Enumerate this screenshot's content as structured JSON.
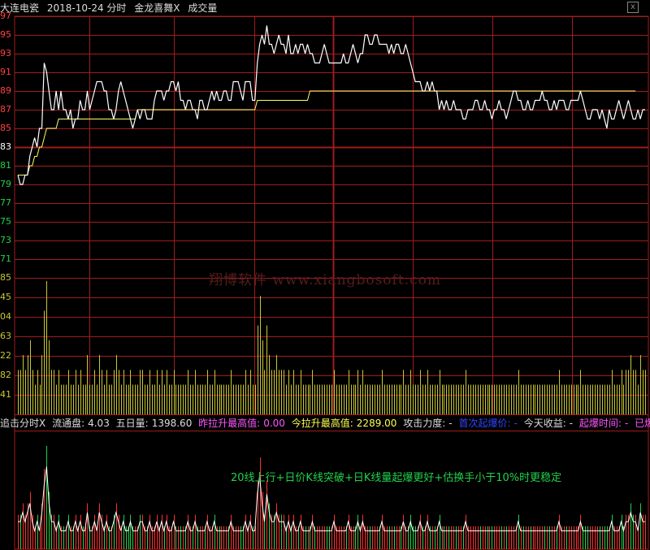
{
  "header": {
    "stock": "大连电瓷",
    "date": "2018-10-24 分时",
    "indicator": "金龙喜舞",
    "close_mark": "X",
    "volume_label": "成交量",
    "close_button": "x"
  },
  "price_axis": [
    "97",
    "95",
    "93",
    "91",
    "89",
    "87",
    "85",
    "83",
    "81",
    "79",
    "77",
    "75",
    "73",
    "71"
  ],
  "volume_axis": [
    "85",
    "45",
    "04",
    "63",
    "22",
    "82",
    "41"
  ],
  "watermark": "翔博软件 www.xiangbosoft.com",
  "info_bar": {
    "title": "追击分时X",
    "float_label": "流通盘:",
    "float_value": "4.03",
    "avg5_label": "五日量:",
    "avg5_value": "1398.60",
    "prev_high_label": "昨拉升最高值:",
    "prev_high_value": "0.00",
    "today_high_label": "今拉升最高值:",
    "today_high_value": "2289.00",
    "attack_label": "攻击力度:",
    "attack_value": "-",
    "first_explode_label": "首次起爆价:",
    "first_explode_value": "-",
    "today_gain_label": "今天收益:",
    "today_gain_value": "-",
    "explode_time_label": "起爆时间:",
    "explode_time_value": "-",
    "explode_minute_label": "已爆分钟:",
    "explode_minute_value": "-"
  },
  "strategy_note": "20线上行+日价K线突破+日K线量起爆更好+估换手小于10%时更稳定",
  "colors": {
    "grid": "#a01c1c",
    "price_line": "#ffffff",
    "avg_line": "#ffff66",
    "volume_bar": "#c8c832",
    "up_bar": "#ff3030",
    "down_bar": "#22d24a",
    "axis_up": "#ff4040",
    "axis_flat": "#ffffff",
    "axis_down": "#22d24a"
  },
  "chart_data": {
    "type": "line",
    "price_series": [
      81,
      80,
      80,
      81,
      81,
      83,
      84,
      85,
      84,
      86,
      86,
      93,
      92,
      90,
      88,
      88,
      90,
      88,
      90,
      88,
      88,
      87,
      88,
      86,
      87,
      87,
      89,
      88,
      88,
      90,
      88,
      89,
      90,
      91,
      91,
      91,
      90,
      90,
      88,
      88,
      87,
      88,
      90,
      91,
      90,
      89,
      88,
      87,
      86,
      87,
      88,
      87,
      88,
      88,
      87,
      87,
      87,
      89,
      90,
      90,
      90,
      89,
      90,
      90,
      91,
      91,
      90,
      91,
      89,
      89,
      88,
      89,
      89,
      88,
      88,
      87,
      89,
      89,
      88,
      88,
      89,
      90,
      89,
      90,
      89,
      89,
      90,
      90,
      89,
      89,
      91,
      91,
      91,
      90,
      89,
      91,
      91,
      91,
      89,
      89,
      93,
      95,
      96,
      95,
      97,
      95,
      95,
      94,
      95,
      96,
      95,
      95,
      94,
      96,
      94,
      94,
      95,
      94,
      95,
      95,
      94,
      95,
      94,
      94,
      93,
      93,
      93,
      94,
      95,
      94,
      93,
      93,
      93,
      93,
      93,
      93,
      94,
      93,
      93,
      94,
      95,
      94,
      93,
      94,
      94,
      96,
      96,
      95,
      95,
      96,
      96,
      95,
      95,
      95,
      95,
      94,
      95,
      94,
      95,
      95,
      94,
      94,
      95,
      94,
      93,
      92,
      91,
      91,
      91,
      90,
      90,
      91,
      90,
      91,
      90,
      90,
      88,
      89,
      88,
      89,
      88,
      88,
      89,
      88,
      88,
      88,
      87,
      87,
      88,
      88,
      88,
      89,
      89,
      88,
      88,
      89,
      88,
      88,
      87,
      88,
      88,
      89,
      88,
      88,
      87,
      88,
      89,
      90,
      90,
      89,
      89,
      88,
      88,
      89,
      88,
      88,
      89,
      89,
      89,
      90,
      89,
      89,
      88,
      88,
      89,
      88,
      89,
      89,
      89,
      88,
      88,
      89,
      89,
      89,
      89,
      90,
      89,
      88,
      87,
      87,
      88,
      88,
      88,
      87,
      88,
      87,
      86,
      88,
      87,
      87,
      88,
      89,
      88,
      87,
      88,
      89,
      88,
      87,
      87,
      88,
      87,
      88,
      88
    ],
    "avg_series": [
      81,
      81,
      81,
      81,
      81,
      82,
      82,
      83,
      83,
      84,
      84,
      85,
      86,
      86,
      86,
      86,
      86,
      87,
      87,
      87,
      87,
      87,
      87,
      87,
      87,
      87,
      87,
      87,
      87,
      87,
      87,
      87,
      87,
      87,
      87,
      87,
      87,
      87,
      87,
      87,
      87,
      87,
      87,
      87,
      87,
      87,
      87,
      87,
      87,
      87,
      88,
      88,
      88,
      88,
      88,
      88,
      88,
      88,
      88,
      88,
      88,
      88,
      88,
      88,
      88,
      88,
      88,
      88,
      88,
      88,
      88,
      88,
      88,
      88,
      88,
      88,
      88,
      88,
      88,
      88,
      88,
      88,
      88,
      88,
      88,
      88,
      88,
      88,
      88,
      88,
      88,
      88,
      88,
      88,
      88,
      88,
      88,
      88,
      88,
      88,
      89,
      89,
      89,
      89,
      89,
      89,
      89,
      89,
      89,
      89,
      89,
      89,
      89,
      89,
      89,
      89,
      89,
      89,
      89,
      89,
      89,
      89,
      90,
      90,
      90,
      90,
      90,
      90,
      90,
      90,
      90,
      90,
      90,
      90,
      90,
      90,
      90,
      90,
      90,
      90,
      90,
      90,
      90,
      90,
      90,
      90,
      90,
      90,
      90,
      90,
      90,
      90,
      90,
      90,
      90,
      90,
      90,
      90,
      90,
      90,
      90,
      90,
      90,
      90,
      90,
      90,
      90,
      90,
      90,
      90,
      90,
      90,
      90,
      90,
      90,
      90,
      90,
      90,
      90,
      90,
      90,
      90,
      90,
      90,
      90,
      90,
      90,
      90,
      90,
      90,
      90,
      90,
      90,
      90,
      90,
      90,
      90,
      90,
      90,
      90,
      90,
      90,
      90,
      90,
      90,
      90,
      90,
      90,
      90,
      90,
      90,
      90,
      90,
      90,
      90,
      90,
      90,
      90,
      90,
      90,
      90,
      90,
      90,
      90,
      90,
      90,
      90,
      90,
      90,
      90,
      90,
      90,
      90,
      90,
      90,
      90,
      90,
      90,
      90,
      90,
      90,
      90,
      90,
      90,
      90,
      90,
      90,
      90,
      90,
      90,
      90,
      90,
      90,
      90,
      90,
      90,
      90,
      90,
      90
    ],
    "volume_series": [
      3,
      3,
      4,
      3,
      4,
      5,
      3,
      2,
      3,
      2,
      4,
      7,
      9,
      5,
      3,
      3,
      2,
      3,
      2,
      2,
      2,
      3,
      2,
      2,
      3,
      2,
      3,
      2,
      2,
      4,
      2,
      2,
      3,
      2,
      4,
      3,
      2,
      3,
      2,
      2,
      3,
      4,
      3,
      2,
      3,
      2,
      2,
      3,
      2,
      2,
      2,
      3,
      3,
      2,
      2,
      3,
      2,
      2,
      3,
      2,
      3,
      2,
      3,
      2,
      2,
      3,
      2,
      2,
      2,
      2,
      2,
      3,
      2,
      2,
      3,
      2,
      2,
      2,
      2,
      3,
      2,
      2,
      3,
      2,
      2,
      2,
      2,
      2,
      2,
      3,
      2,
      2,
      2,
      2,
      2,
      3,
      2,
      3,
      2,
      2,
      6,
      8,
      5,
      3,
      6,
      4,
      3,
      3,
      4,
      3,
      3,
      3,
      2,
      3,
      2,
      3,
      2,
      2,
      3,
      2,
      2,
      2,
      2,
      3,
      2,
      2,
      2,
      2,
      2,
      2,
      2,
      2,
      3,
      2,
      2,
      2,
      2,
      2,
      3,
      2,
      2,
      2,
      3,
      2,
      3,
      2,
      2,
      2,
      2,
      2,
      2,
      2,
      3,
      2,
      2,
      2,
      2,
      2,
      2,
      2,
      2,
      3,
      2,
      2,
      3,
      2,
      2,
      2,
      3,
      2,
      2,
      3,
      2,
      2,
      2,
      2,
      3,
      2,
      2,
      2,
      2,
      2,
      2,
      2,
      2,
      2,
      2,
      3,
      2,
      2,
      2,
      2,
      2,
      2,
      2,
      2,
      2,
      2,
      2,
      2,
      2,
      2,
      2,
      2,
      2,
      2,
      2,
      2,
      2,
      3,
      2,
      2,
      2,
      2,
      2,
      2,
      2,
      2,
      2,
      2,
      2,
      2,
      2,
      2,
      2,
      2,
      3,
      2,
      2,
      2,
      2,
      2,
      2,
      2,
      2,
      3,
      2,
      2,
      2,
      2,
      2,
      2,
      2,
      2,
      2,
      2,
      2,
      2,
      3,
      2,
      2,
      2,
      3,
      2,
      3,
      3,
      4,
      3,
      3,
      2,
      4,
      3,
      3
    ],
    "ylim_price": [
      70,
      98
    ],
    "ylim_volume": [
      0,
      9
    ]
  }
}
